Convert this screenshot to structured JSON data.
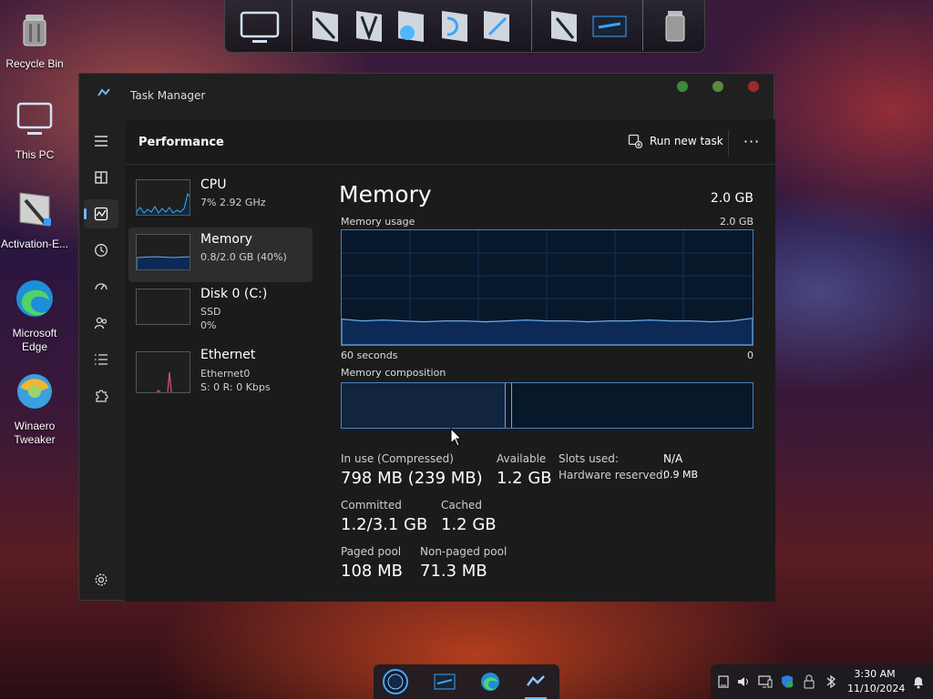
{
  "desktop": {
    "icons": [
      {
        "label": "Recycle Bin"
      },
      {
        "label": "This PC"
      },
      {
        "label": "Activation-E..."
      },
      {
        "label": "Microsoft Edge"
      },
      {
        "label": "Winaero Tweaker"
      }
    ]
  },
  "window": {
    "title": "Task Manager",
    "header": {
      "title": "Performance",
      "run_new_task": "Run new task",
      "more": "···"
    },
    "perf_list": [
      {
        "name": "CPU",
        "sub1": "7% 2.92 GHz",
        "sub2": ""
      },
      {
        "name": "Memory",
        "sub1": "0.8/2.0 GB (40%)",
        "sub2": ""
      },
      {
        "name": "Disk 0 (C:)",
        "sub1": "SSD",
        "sub2": "0%"
      },
      {
        "name": "Ethernet",
        "sub1": "Ethernet0",
        "sub2": "S: 0 R: 0 Kbps"
      }
    ],
    "memory": {
      "title": "Memory",
      "total": "2.0 GB",
      "usage_label": "Memory usage",
      "usage_max": "2.0 GB",
      "time_label": "60 seconds",
      "time_end": "0",
      "composition_label": "Memory composition",
      "usage_fraction": 0.4,
      "composition": {
        "in_use_fraction": 0.4,
        "modified_fraction": 0.005,
        "standby_fraction": 0.0
      }
    },
    "stats": {
      "in_use_label": "In use (Compressed)",
      "in_use_value": "798 MB (239 MB)",
      "available_label": "Available",
      "available_value": "1.2 GB",
      "committed_label": "Committed",
      "committed_value": "1.2/3.1 GB",
      "cached_label": "Cached",
      "cached_value": "1.2 GB",
      "paged_label": "Paged pool",
      "paged_value": "108 MB",
      "nonpaged_label": "Non-paged pool",
      "nonpaged_value": "71.3 MB",
      "slots_label": "Slots used:",
      "slots_value": "N/A",
      "hw_label": "Hardware reserved:",
      "hw_value": "0.9 MB"
    }
  },
  "taskbar": {
    "time": "3:30 AM",
    "date": "11/10/2024"
  },
  "colors": {
    "accent": "#6cb8ff",
    "graph_fill": "#0c2a55",
    "graph_line": "#6fa8e8",
    "close": "#9b2b2b",
    "min": "#3b8a3b",
    "max": "#5c8a3b"
  }
}
